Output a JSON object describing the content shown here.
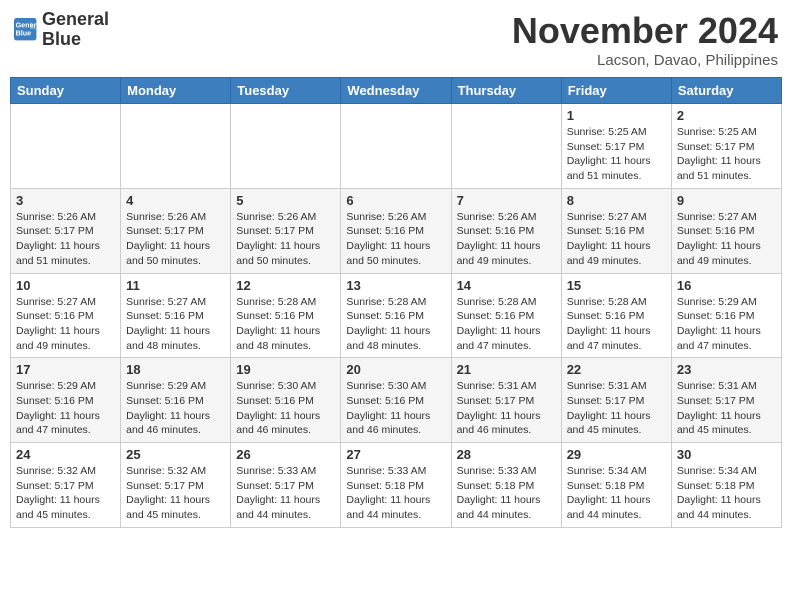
{
  "header": {
    "logo_line1": "General",
    "logo_line2": "Blue",
    "month_title": "November 2024",
    "location": "Lacson, Davao, Philippines"
  },
  "weekdays": [
    "Sunday",
    "Monday",
    "Tuesday",
    "Wednesday",
    "Thursday",
    "Friday",
    "Saturday"
  ],
  "weeks": [
    [
      {
        "day": "",
        "info": ""
      },
      {
        "day": "",
        "info": ""
      },
      {
        "day": "",
        "info": ""
      },
      {
        "day": "",
        "info": ""
      },
      {
        "day": "",
        "info": ""
      },
      {
        "day": "1",
        "info": "Sunrise: 5:25 AM\nSunset: 5:17 PM\nDaylight: 11 hours and 51 minutes."
      },
      {
        "day": "2",
        "info": "Sunrise: 5:25 AM\nSunset: 5:17 PM\nDaylight: 11 hours and 51 minutes."
      }
    ],
    [
      {
        "day": "3",
        "info": "Sunrise: 5:26 AM\nSunset: 5:17 PM\nDaylight: 11 hours and 51 minutes."
      },
      {
        "day": "4",
        "info": "Sunrise: 5:26 AM\nSunset: 5:17 PM\nDaylight: 11 hours and 50 minutes."
      },
      {
        "day": "5",
        "info": "Sunrise: 5:26 AM\nSunset: 5:17 PM\nDaylight: 11 hours and 50 minutes."
      },
      {
        "day": "6",
        "info": "Sunrise: 5:26 AM\nSunset: 5:16 PM\nDaylight: 11 hours and 50 minutes."
      },
      {
        "day": "7",
        "info": "Sunrise: 5:26 AM\nSunset: 5:16 PM\nDaylight: 11 hours and 49 minutes."
      },
      {
        "day": "8",
        "info": "Sunrise: 5:27 AM\nSunset: 5:16 PM\nDaylight: 11 hours and 49 minutes."
      },
      {
        "day": "9",
        "info": "Sunrise: 5:27 AM\nSunset: 5:16 PM\nDaylight: 11 hours and 49 minutes."
      }
    ],
    [
      {
        "day": "10",
        "info": "Sunrise: 5:27 AM\nSunset: 5:16 PM\nDaylight: 11 hours and 49 minutes."
      },
      {
        "day": "11",
        "info": "Sunrise: 5:27 AM\nSunset: 5:16 PM\nDaylight: 11 hours and 48 minutes."
      },
      {
        "day": "12",
        "info": "Sunrise: 5:28 AM\nSunset: 5:16 PM\nDaylight: 11 hours and 48 minutes."
      },
      {
        "day": "13",
        "info": "Sunrise: 5:28 AM\nSunset: 5:16 PM\nDaylight: 11 hours and 48 minutes."
      },
      {
        "day": "14",
        "info": "Sunrise: 5:28 AM\nSunset: 5:16 PM\nDaylight: 11 hours and 47 minutes."
      },
      {
        "day": "15",
        "info": "Sunrise: 5:28 AM\nSunset: 5:16 PM\nDaylight: 11 hours and 47 minutes."
      },
      {
        "day": "16",
        "info": "Sunrise: 5:29 AM\nSunset: 5:16 PM\nDaylight: 11 hours and 47 minutes."
      }
    ],
    [
      {
        "day": "17",
        "info": "Sunrise: 5:29 AM\nSunset: 5:16 PM\nDaylight: 11 hours and 47 minutes."
      },
      {
        "day": "18",
        "info": "Sunrise: 5:29 AM\nSunset: 5:16 PM\nDaylight: 11 hours and 46 minutes."
      },
      {
        "day": "19",
        "info": "Sunrise: 5:30 AM\nSunset: 5:16 PM\nDaylight: 11 hours and 46 minutes."
      },
      {
        "day": "20",
        "info": "Sunrise: 5:30 AM\nSunset: 5:16 PM\nDaylight: 11 hours and 46 minutes."
      },
      {
        "day": "21",
        "info": "Sunrise: 5:31 AM\nSunset: 5:17 PM\nDaylight: 11 hours and 46 minutes."
      },
      {
        "day": "22",
        "info": "Sunrise: 5:31 AM\nSunset: 5:17 PM\nDaylight: 11 hours and 45 minutes."
      },
      {
        "day": "23",
        "info": "Sunrise: 5:31 AM\nSunset: 5:17 PM\nDaylight: 11 hours and 45 minutes."
      }
    ],
    [
      {
        "day": "24",
        "info": "Sunrise: 5:32 AM\nSunset: 5:17 PM\nDaylight: 11 hours and 45 minutes."
      },
      {
        "day": "25",
        "info": "Sunrise: 5:32 AM\nSunset: 5:17 PM\nDaylight: 11 hours and 45 minutes."
      },
      {
        "day": "26",
        "info": "Sunrise: 5:33 AM\nSunset: 5:17 PM\nDaylight: 11 hours and 44 minutes."
      },
      {
        "day": "27",
        "info": "Sunrise: 5:33 AM\nSunset: 5:18 PM\nDaylight: 11 hours and 44 minutes."
      },
      {
        "day": "28",
        "info": "Sunrise: 5:33 AM\nSunset: 5:18 PM\nDaylight: 11 hours and 44 minutes."
      },
      {
        "day": "29",
        "info": "Sunrise: 5:34 AM\nSunset: 5:18 PM\nDaylight: 11 hours and 44 minutes."
      },
      {
        "day": "30",
        "info": "Sunrise: 5:34 AM\nSunset: 5:18 PM\nDaylight: 11 hours and 44 minutes."
      }
    ]
  ]
}
